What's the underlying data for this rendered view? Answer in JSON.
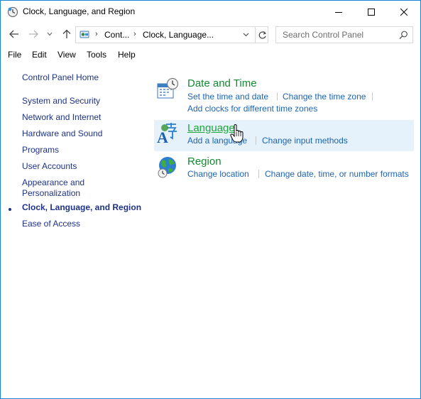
{
  "window": {
    "title": "Clock, Language, and Region",
    "controls": {
      "minimize": "minimize",
      "maximize": "maximize",
      "close": "close"
    }
  },
  "address": {
    "crumb1": "Cont...",
    "crumb2": "Clock, Language..."
  },
  "search": {
    "placeholder": "Search Control Panel",
    "value": ""
  },
  "menu": [
    "File",
    "Edit",
    "View",
    "Tools",
    "Help"
  ],
  "sidebar": {
    "home": "Control Panel Home",
    "items": [
      {
        "label": "System and Security"
      },
      {
        "label": "Network and Internet"
      },
      {
        "label": "Hardware and Sound"
      },
      {
        "label": "Programs"
      },
      {
        "label": "User Accounts"
      },
      {
        "label": "Appearance and\nPersonalization"
      },
      {
        "label": "Clock, Language, and Region",
        "current": true
      },
      {
        "label": "Ease of Access"
      }
    ]
  },
  "categories": [
    {
      "title": "Date and Time",
      "icon": "calendar-clock-icon",
      "links": [
        "Set the time and date",
        "Change the time zone",
        "Add clocks for different time zones"
      ]
    },
    {
      "title": "Language",
      "icon": "language-icon",
      "hover": true,
      "links": [
        "Add a language",
        "Change input methods"
      ]
    },
    {
      "title": "Region",
      "icon": "globe-clock-icon",
      "links": [
        "Change location",
        "Change date, time, or number formats"
      ]
    }
  ],
  "colors": {
    "title_green": "#128a31",
    "hover_green": "#1ea83c",
    "link_blue": "#1c64b4",
    "nav_blue": "#1e3287",
    "hover_bg": "#e5f1fb",
    "window_border": "#1883d7"
  }
}
